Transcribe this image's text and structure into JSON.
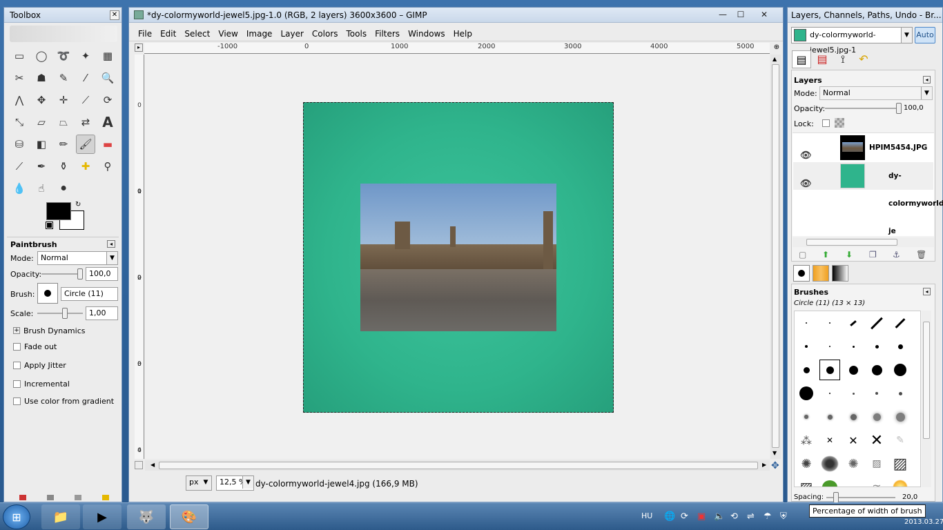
{
  "toolbox": {
    "title": "Toolbox",
    "options_title": "Paintbrush",
    "mode_label": "Mode:",
    "mode_value": "Normal",
    "opacity_label": "Opacity:",
    "opacity_value": "100,0",
    "brush_label": "Brush:",
    "brush_value": "Circle (11)",
    "scale_label": "Scale:",
    "scale_value": "1,00",
    "brush_dynamics": "Brush Dynamics",
    "fade_out": "Fade out",
    "apply_jitter": "Apply Jitter",
    "incremental": "Incremental",
    "use_color": "Use color from gradient",
    "fg_color": "#000000",
    "bg_color": "#ffffff"
  },
  "main": {
    "title": "*dy-colormyworld-jewel5.jpg-1.0 (RGB, 2 layers) 3600x3600 – GIMP",
    "menu": [
      "File",
      "Edit",
      "Select",
      "View",
      "Image",
      "Layer",
      "Colors",
      "Tools",
      "Filters",
      "Windows",
      "Help"
    ],
    "ruler_top": [
      "-1000",
      "0",
      "1000",
      "2000",
      "3000",
      "4000",
      "5000"
    ],
    "ruler_left": [
      [
        "0"
      ],
      [
        "1",
        "0",
        "0",
        "0"
      ],
      [
        "2",
        "0",
        "0",
        "0"
      ],
      [
        "3",
        "0",
        "0",
        "0"
      ],
      [
        "4",
        "0"
      ]
    ],
    "unit": "px",
    "zoom": "12,5 %",
    "status": "dy-colormyworld-jewel4.jpg (166,9 MB)",
    "canvas_color": "#2fb48c"
  },
  "dock": {
    "title": "Layers, Channels, Paths, Undo - Br...",
    "image_select": "dy-colormyworld-jewel5.jpg-1",
    "auto": "Auto",
    "layers_title": "Layers",
    "mode_label": "Mode:",
    "mode_value": "Normal",
    "opacity_label": "Opacity:",
    "opacity_value": "100,0",
    "lock_label": "Lock:",
    "layers": [
      {
        "name": "HPIM5454.JPG"
      },
      {
        "name": "dy-colormyworld-je"
      }
    ],
    "brushes_title": "Brushes",
    "brush_info": "Circle (11) (13 × 13)",
    "spacing_label": "Spacing:",
    "spacing_value": "20,0",
    "tooltip": "Percentage of width of brush"
  },
  "taskbar": {
    "lang": "HU",
    "date": "2013.03.27."
  }
}
